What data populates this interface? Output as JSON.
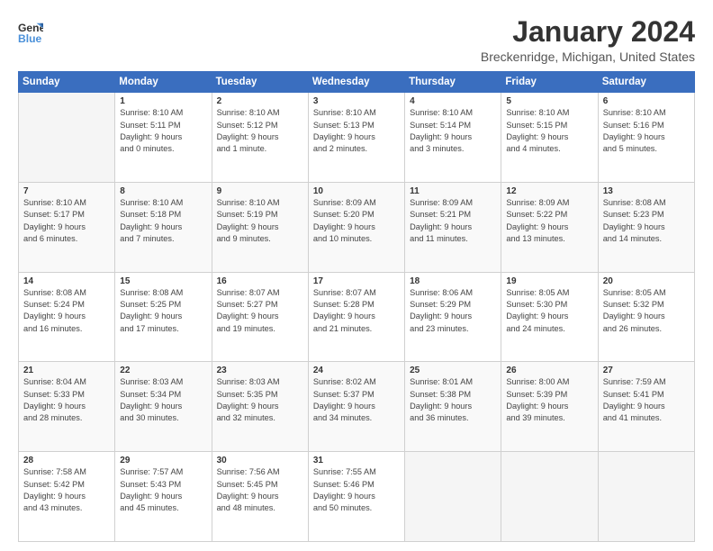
{
  "logo": {
    "line1": "General",
    "line2": "Blue"
  },
  "title": "January 2024",
  "subtitle": "Breckenridge, Michigan, United States",
  "days_header": [
    "Sunday",
    "Monday",
    "Tuesday",
    "Wednesday",
    "Thursday",
    "Friday",
    "Saturday"
  ],
  "weeks": [
    [
      {
        "num": "",
        "info": "",
        "empty": true
      },
      {
        "num": "1",
        "info": "Sunrise: 8:10 AM\nSunset: 5:11 PM\nDaylight: 9 hours\nand 0 minutes."
      },
      {
        "num": "2",
        "info": "Sunrise: 8:10 AM\nSunset: 5:12 PM\nDaylight: 9 hours\nand 1 minute."
      },
      {
        "num": "3",
        "info": "Sunrise: 8:10 AM\nSunset: 5:13 PM\nDaylight: 9 hours\nand 2 minutes."
      },
      {
        "num": "4",
        "info": "Sunrise: 8:10 AM\nSunset: 5:14 PM\nDaylight: 9 hours\nand 3 minutes."
      },
      {
        "num": "5",
        "info": "Sunrise: 8:10 AM\nSunset: 5:15 PM\nDaylight: 9 hours\nand 4 minutes."
      },
      {
        "num": "6",
        "info": "Sunrise: 8:10 AM\nSunset: 5:16 PM\nDaylight: 9 hours\nand 5 minutes."
      }
    ],
    [
      {
        "num": "7",
        "info": "Sunrise: 8:10 AM\nSunset: 5:17 PM\nDaylight: 9 hours\nand 6 minutes."
      },
      {
        "num": "8",
        "info": "Sunrise: 8:10 AM\nSunset: 5:18 PM\nDaylight: 9 hours\nand 7 minutes."
      },
      {
        "num": "9",
        "info": "Sunrise: 8:10 AM\nSunset: 5:19 PM\nDaylight: 9 hours\nand 9 minutes."
      },
      {
        "num": "10",
        "info": "Sunrise: 8:09 AM\nSunset: 5:20 PM\nDaylight: 9 hours\nand 10 minutes."
      },
      {
        "num": "11",
        "info": "Sunrise: 8:09 AM\nSunset: 5:21 PM\nDaylight: 9 hours\nand 11 minutes."
      },
      {
        "num": "12",
        "info": "Sunrise: 8:09 AM\nSunset: 5:22 PM\nDaylight: 9 hours\nand 13 minutes."
      },
      {
        "num": "13",
        "info": "Sunrise: 8:08 AM\nSunset: 5:23 PM\nDaylight: 9 hours\nand 14 minutes."
      }
    ],
    [
      {
        "num": "14",
        "info": "Sunrise: 8:08 AM\nSunset: 5:24 PM\nDaylight: 9 hours\nand 16 minutes."
      },
      {
        "num": "15",
        "info": "Sunrise: 8:08 AM\nSunset: 5:25 PM\nDaylight: 9 hours\nand 17 minutes."
      },
      {
        "num": "16",
        "info": "Sunrise: 8:07 AM\nSunset: 5:27 PM\nDaylight: 9 hours\nand 19 minutes."
      },
      {
        "num": "17",
        "info": "Sunrise: 8:07 AM\nSunset: 5:28 PM\nDaylight: 9 hours\nand 21 minutes."
      },
      {
        "num": "18",
        "info": "Sunrise: 8:06 AM\nSunset: 5:29 PM\nDaylight: 9 hours\nand 23 minutes."
      },
      {
        "num": "19",
        "info": "Sunrise: 8:05 AM\nSunset: 5:30 PM\nDaylight: 9 hours\nand 24 minutes."
      },
      {
        "num": "20",
        "info": "Sunrise: 8:05 AM\nSunset: 5:32 PM\nDaylight: 9 hours\nand 26 minutes."
      }
    ],
    [
      {
        "num": "21",
        "info": "Sunrise: 8:04 AM\nSunset: 5:33 PM\nDaylight: 9 hours\nand 28 minutes."
      },
      {
        "num": "22",
        "info": "Sunrise: 8:03 AM\nSunset: 5:34 PM\nDaylight: 9 hours\nand 30 minutes."
      },
      {
        "num": "23",
        "info": "Sunrise: 8:03 AM\nSunset: 5:35 PM\nDaylight: 9 hours\nand 32 minutes."
      },
      {
        "num": "24",
        "info": "Sunrise: 8:02 AM\nSunset: 5:37 PM\nDaylight: 9 hours\nand 34 minutes."
      },
      {
        "num": "25",
        "info": "Sunrise: 8:01 AM\nSunset: 5:38 PM\nDaylight: 9 hours\nand 36 minutes."
      },
      {
        "num": "26",
        "info": "Sunrise: 8:00 AM\nSunset: 5:39 PM\nDaylight: 9 hours\nand 39 minutes."
      },
      {
        "num": "27",
        "info": "Sunrise: 7:59 AM\nSunset: 5:41 PM\nDaylight: 9 hours\nand 41 minutes."
      }
    ],
    [
      {
        "num": "28",
        "info": "Sunrise: 7:58 AM\nSunset: 5:42 PM\nDaylight: 9 hours\nand 43 minutes."
      },
      {
        "num": "29",
        "info": "Sunrise: 7:57 AM\nSunset: 5:43 PM\nDaylight: 9 hours\nand 45 minutes."
      },
      {
        "num": "30",
        "info": "Sunrise: 7:56 AM\nSunset: 5:45 PM\nDaylight: 9 hours\nand 48 minutes."
      },
      {
        "num": "31",
        "info": "Sunrise: 7:55 AM\nSunset: 5:46 PM\nDaylight: 9 hours\nand 50 minutes."
      },
      {
        "num": "",
        "info": "",
        "empty": true
      },
      {
        "num": "",
        "info": "",
        "empty": true
      },
      {
        "num": "",
        "info": "",
        "empty": true
      }
    ]
  ]
}
